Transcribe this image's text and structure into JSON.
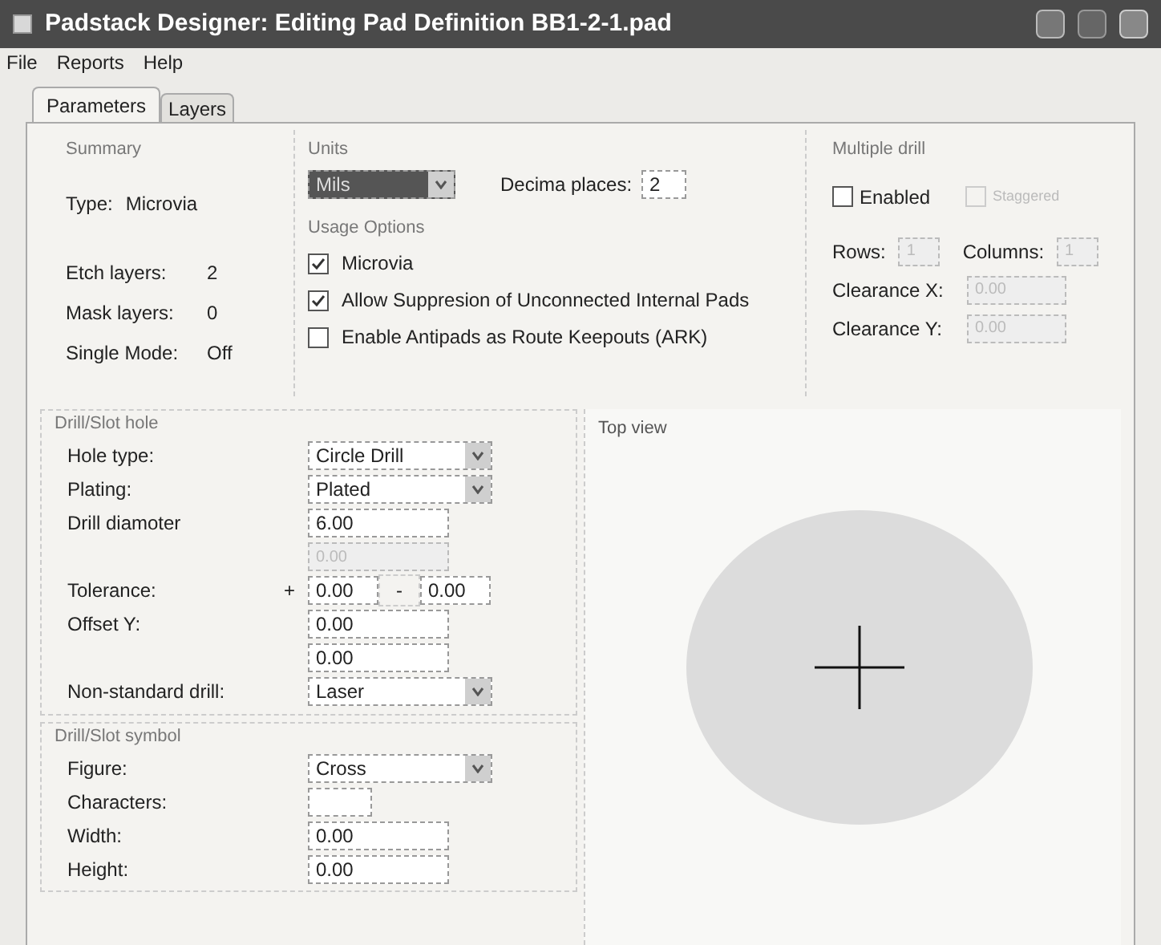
{
  "window": {
    "title": "Padstack Designer: Editing Pad Definition BB1-2-1.pad"
  },
  "menu": [
    "File",
    "Reports",
    "Help"
  ],
  "tabs": [
    {
      "label": "Parameters",
      "selected": true
    },
    {
      "label": "Layers",
      "selected": false
    }
  ],
  "summary": {
    "title": "Summary",
    "rows": [
      {
        "label": "Type:",
        "value": "Microvia"
      },
      {
        "label": "Etch layers:",
        "value": "2"
      },
      {
        "label": "Mask layers:",
        "value": "0"
      },
      {
        "label": "Single Mode:",
        "value": "Off"
      }
    ]
  },
  "units": {
    "title": "Units",
    "unit": "Mils",
    "decimal_label": "Decima places:",
    "decimal_value": "2"
  },
  "usage_options": {
    "title": "Usage Options",
    "options": [
      {
        "label": "Microvia",
        "checked": true
      },
      {
        "label": "Allow Suppresion of Unconnected Internal Pads",
        "checked": true
      },
      {
        "label": "Enable Antipads as Route Keepouts (ARK)",
        "checked": false
      }
    ]
  },
  "multiple_drill": {
    "title": "Multiple drill",
    "enabled": {
      "label": "Enabled",
      "checked": false
    },
    "staggered": {
      "label": "Staggered",
      "checked": false,
      "disabled": true
    },
    "rows": {
      "label": "Rows:",
      "value": "1",
      "disabled": true
    },
    "columns": {
      "label": "Columns:",
      "value": "1",
      "disabled": true
    },
    "clearance": [
      {
        "label": "Clearance X:",
        "value": "0.00",
        "disabled": true
      },
      {
        "label": "Clearance Y:",
        "value": "0.00",
        "disabled": true
      }
    ]
  },
  "drill_hole": {
    "title": "Drill/Slot hole",
    "fields": [
      {
        "kind": "select",
        "label": "Hole type:",
        "value": "Circle Drill"
      },
      {
        "kind": "select",
        "label": "Plating:",
        "value": "Plated"
      },
      {
        "kind": "input",
        "label": "Drill diamoter",
        "value": "6.00",
        "disabled": false
      },
      {
        "kind": "input",
        "value": "0.00",
        "disabled": true
      },
      {
        "kind": "tolerance",
        "label": "Tolerance:",
        "plus": "+",
        "value": "0.00",
        "minus": "-",
        "value2": "0.00"
      },
      {
        "kind": "input",
        "label": "Offset Y:",
        "value": "0.00",
        "disabled": false
      },
      {
        "kind": "input",
        "value": "0.00",
        "disabled": false
      },
      {
        "kind": "select",
        "label": "Non-standard drill:",
        "value": "Laser"
      }
    ]
  },
  "drill_symbol": {
    "title": "Drill/Slot symbol",
    "fields": [
      {
        "kind": "select",
        "label": "Figure:",
        "value": "Cross"
      },
      {
        "kind": "short_input",
        "label": "Characters:"
      },
      {
        "kind": "input",
        "label": "Width:",
        "value": "0.00",
        "disabled": false
      },
      {
        "kind": "input",
        "label": "Height:",
        "value": "0.00",
        "disabled": false
      }
    ]
  },
  "top_view": {
    "title": "Top view"
  }
}
